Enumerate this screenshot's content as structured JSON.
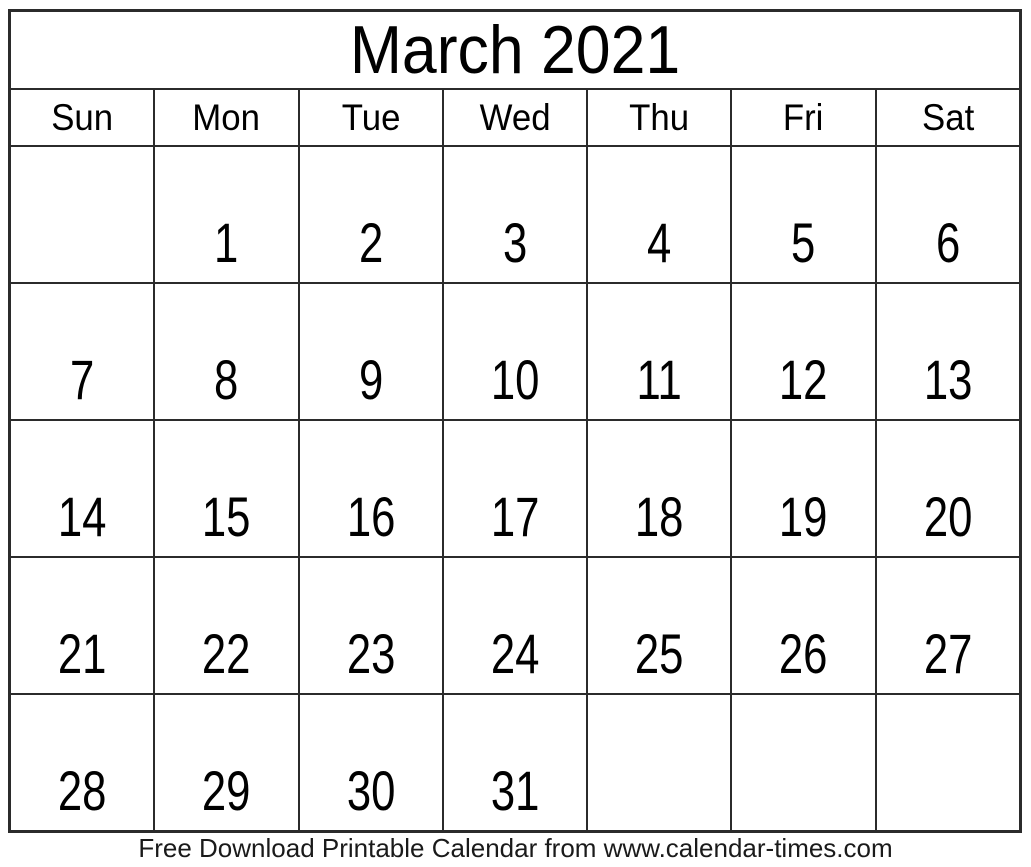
{
  "calendar": {
    "title": "March 2021",
    "month_name": "March",
    "year": "2021",
    "weekday_headers": [
      "Sun",
      "Mon",
      "Tue",
      "Wed",
      "Thu",
      "Fri",
      "Sat"
    ],
    "weeks": [
      [
        "",
        "1",
        "2",
        "3",
        "4",
        "5",
        "6"
      ],
      [
        "7",
        "8",
        "9",
        "10",
        "11",
        "12",
        "13"
      ],
      [
        "14",
        "15",
        "16",
        "17",
        "18",
        "19",
        "20"
      ],
      [
        "21",
        "22",
        "23",
        "24",
        "25",
        "26",
        "27"
      ],
      [
        "28",
        "29",
        "30",
        "31",
        "",
        "",
        ""
      ]
    ],
    "first_day_of_week": "Sun",
    "days_in_month": "31",
    "colors": {
      "background": "#ffffff",
      "text": "#000000",
      "border": "#2b2b2b",
      "footer_text": "#1a1a1a"
    }
  },
  "footer": {
    "text": "Free Download Printable Calendar from www.calendar-times.com",
    "site": "www.calendar-times.com"
  }
}
